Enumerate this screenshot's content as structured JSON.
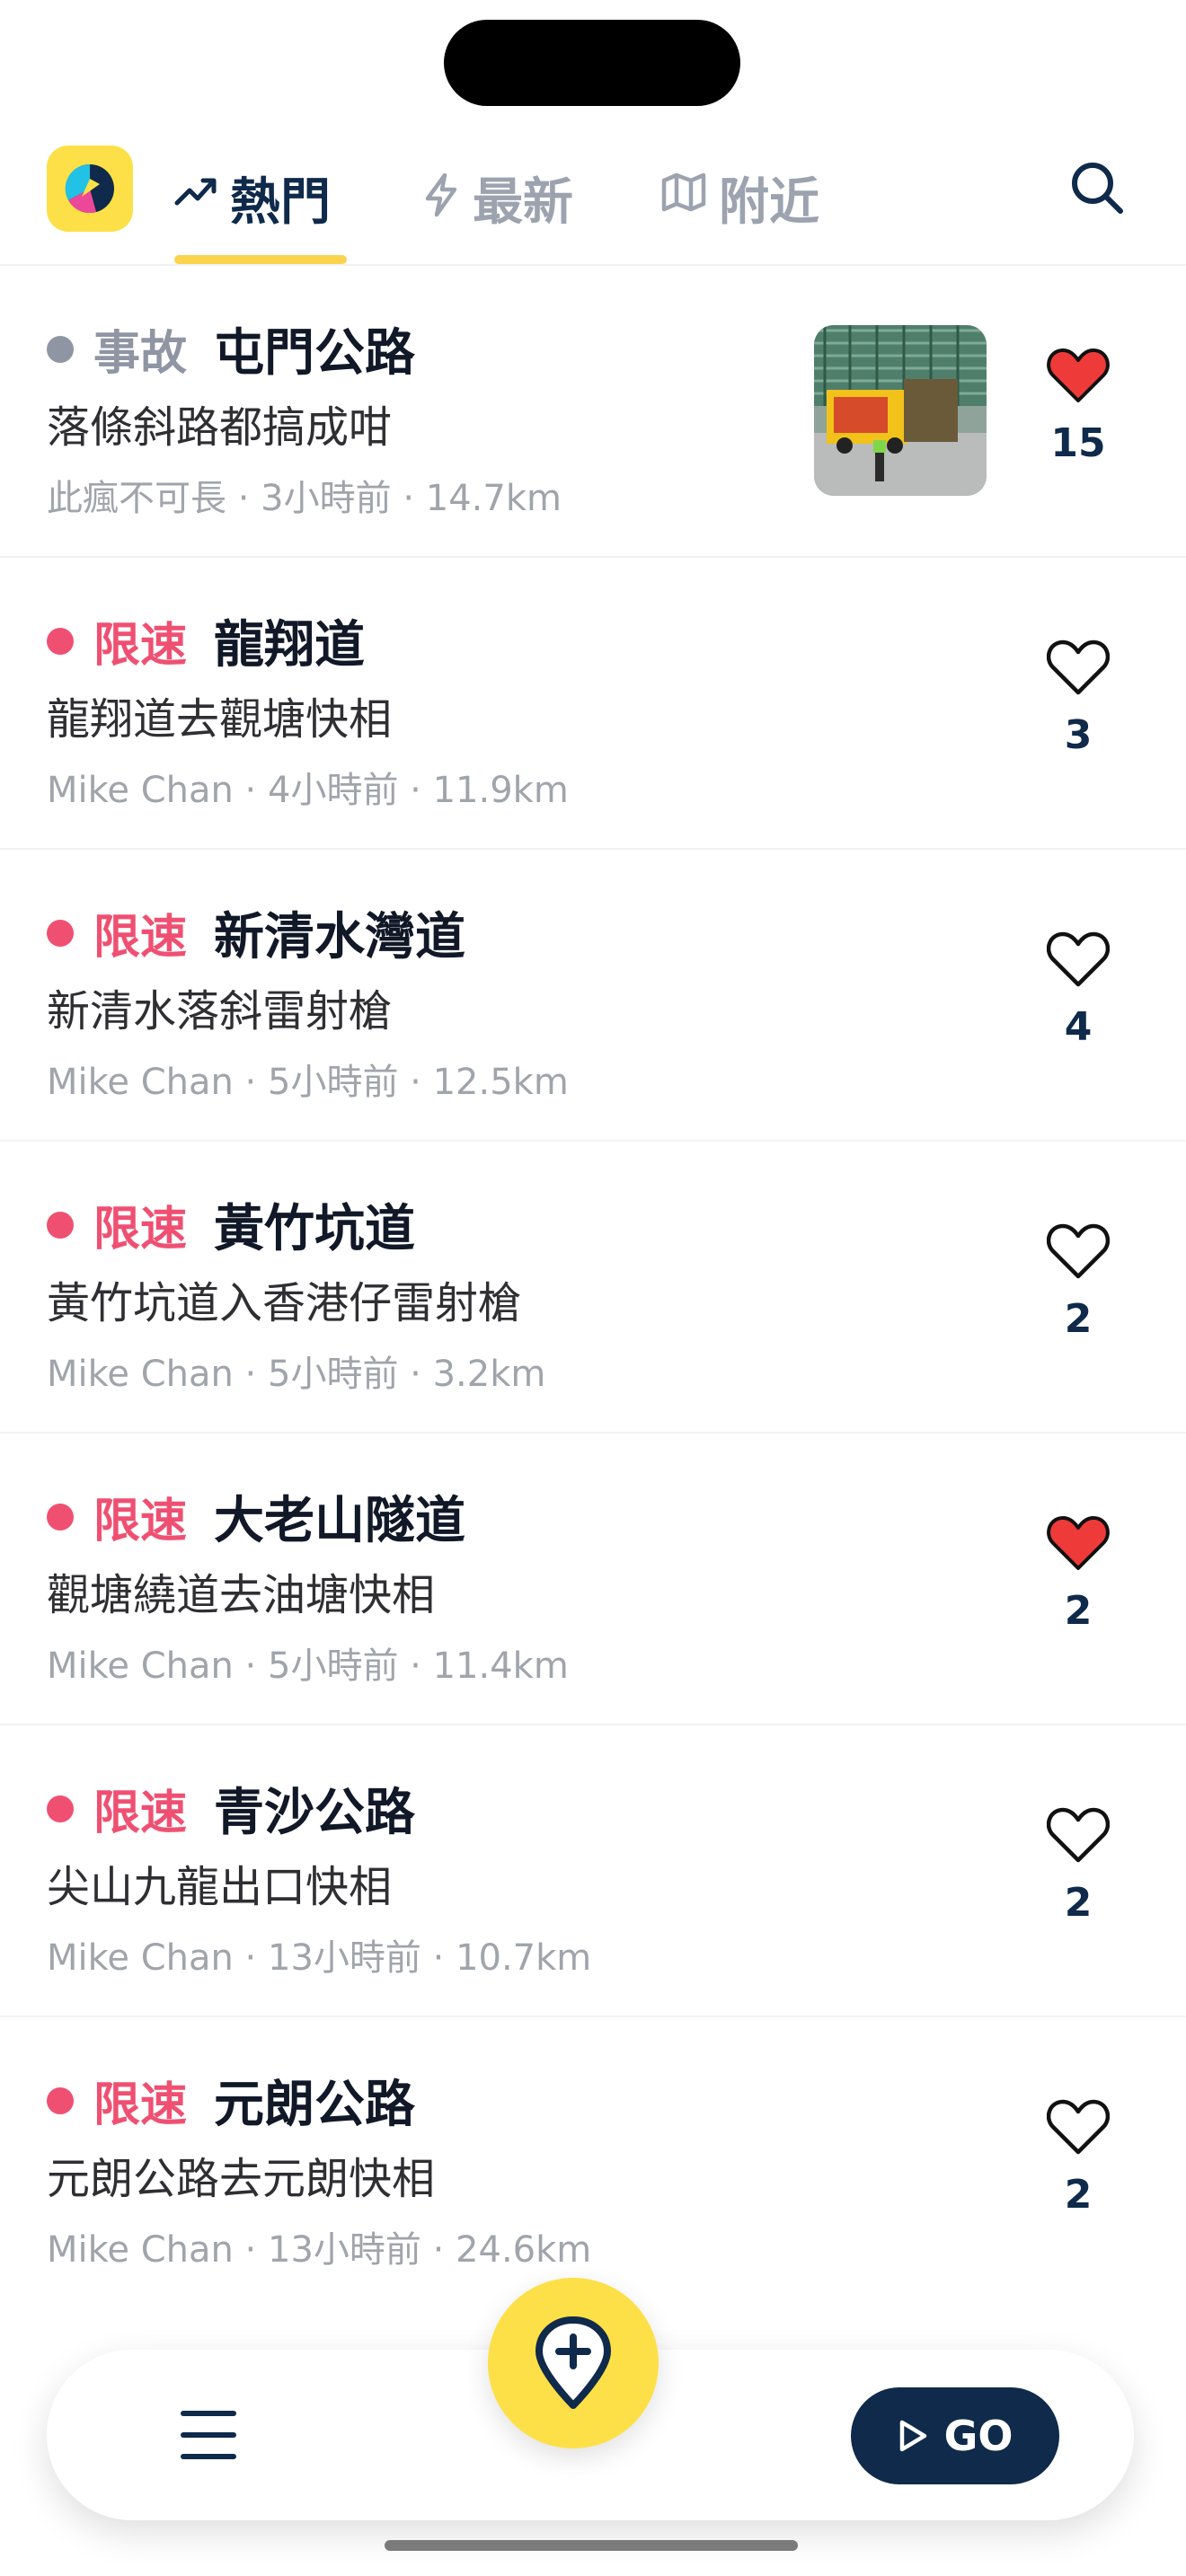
{
  "tabs": [
    {
      "label": "熱門",
      "icon": "trending-icon",
      "active": true
    },
    {
      "label": "最新",
      "icon": "bolt-icon",
      "active": false
    },
    {
      "label": "附近",
      "icon": "map-icon",
      "active": false
    }
  ],
  "colors": {
    "accent": "#fde047",
    "navy": "#0f2a4a",
    "speed": "#ef5072",
    "accident": "#8f95a3"
  },
  "reports": [
    {
      "category": "事故",
      "type": "accident",
      "road": "屯門公路",
      "description": "落條斜路都搞成咁",
      "author": "此瘋不可長",
      "time": "3小時前",
      "distance": "14.7km",
      "likes": "15",
      "liked": true,
      "has_photo": true
    },
    {
      "category": "限速",
      "type": "speed",
      "road": "龍翔道",
      "description": "龍翔道去觀塘快相",
      "author": "Mike Chan",
      "time": "4小時前",
      "distance": "11.9km",
      "likes": "3",
      "liked": false,
      "has_photo": false
    },
    {
      "category": "限速",
      "type": "speed",
      "road": "新清水灣道",
      "description": "新清水落斜雷射槍",
      "author": "Mike Chan",
      "time": "5小時前",
      "distance": "12.5km",
      "likes": "4",
      "liked": false,
      "has_photo": false
    },
    {
      "category": "限速",
      "type": "speed",
      "road": "黃竹坑道",
      "description": "黃竹坑道入香港仔雷射槍",
      "author": "Mike Chan",
      "time": "5小時前",
      "distance": "3.2km",
      "likes": "2",
      "liked": false,
      "has_photo": false
    },
    {
      "category": "限速",
      "type": "speed",
      "road": "大老山隧道",
      "description": "觀塘繞道去油塘快相",
      "author": "Mike Chan",
      "time": "5小時前",
      "distance": "11.4km",
      "likes": "2",
      "liked": true,
      "has_photo": false
    },
    {
      "category": "限速",
      "type": "speed",
      "road": "青沙公路",
      "description": "尖山九龍出口快相",
      "author": "Mike Chan",
      "time": "13小時前",
      "distance": "10.7km",
      "likes": "2",
      "liked": false,
      "has_photo": false
    },
    {
      "category": "限速",
      "type": "speed",
      "road": "元朗公路",
      "description": "元朗公路去元朗快相",
      "author": "Mike Chan",
      "time": "13小時前",
      "distance": "24.6km",
      "likes": "2",
      "liked": false,
      "has_photo": false
    }
  ],
  "bottom": {
    "go_label": "GO"
  }
}
